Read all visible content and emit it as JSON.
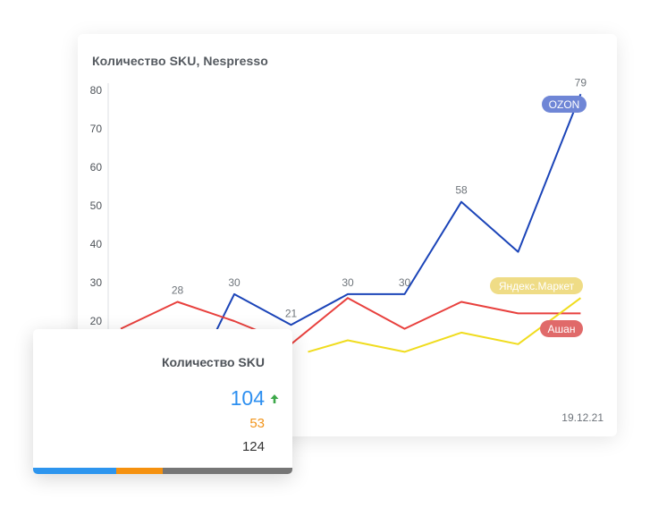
{
  "chart_card": {
    "title": "Количество SKU, Nespresso",
    "date": "19.12.21"
  },
  "chart_data": {
    "type": "line",
    "title": "Количество SKU, Nespresso",
    "ylim": [
      12,
      80
    ],
    "yticks": [
      20,
      30,
      40,
      50,
      60,
      70,
      80
    ],
    "grid": false,
    "n_points": 10,
    "series": [
      {
        "name": "OZON",
        "color": "#1b44b8",
        "label_bg": "#6f86d6",
        "values": [
          null,
          12,
          27,
          19,
          27,
          27,
          51,
          38,
          79
        ],
        "x_index": [
          0,
          1.5,
          2,
          3,
          4,
          5,
          6,
          7,
          8.1
        ],
        "value_labels": [
          null,
          null,
          "30",
          "21",
          "30",
          "30",
          "58",
          null,
          "79"
        ]
      },
      {
        "name": "Ашан",
        "color": "#e8403d",
        "label_bg": "#e06a6a",
        "values": [
          18,
          25,
          20,
          14,
          26,
          18,
          25,
          22,
          22
        ],
        "x_index": [
          0,
          1,
          2,
          3,
          4,
          5,
          6,
          7,
          8.1
        ],
        "value_labels": [
          null,
          "28",
          null,
          null,
          null,
          null,
          null,
          null,
          null
        ]
      },
      {
        "name": "Яндекс.Маркет",
        "color": "#f0dc1e",
        "label_bg": "#efdc86",
        "values": [
          null,
          null,
          null,
          12,
          15,
          12,
          17,
          14,
          26
        ],
        "x_index": [
          0,
          1,
          2,
          3.3,
          4,
          5,
          6,
          7,
          8.1
        ],
        "value_labels": [
          null,
          null,
          null,
          null,
          null,
          null,
          null,
          null,
          null
        ]
      }
    ]
  },
  "kpi_card": {
    "title": "Количество SKU",
    "main_value": "104",
    "second_value": "53",
    "third_value": "124",
    "bar": [
      {
        "color": "#2d95ee",
        "fraction": 0.32
      },
      {
        "color": "#f5910f",
        "fraction": 0.18
      },
      {
        "color": "#767676",
        "fraction": 0.5
      }
    ],
    "arrow_color": "#3da84a"
  }
}
